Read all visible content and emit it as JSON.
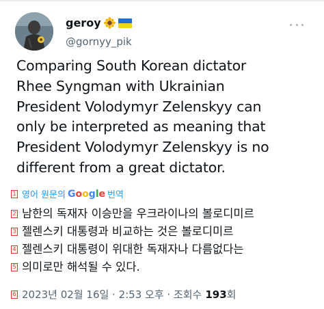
{
  "author": {
    "display_name": "geroy",
    "handle": "@gornyy_pik",
    "avatar_icon": "profile-avatar",
    "name_emojis": [
      "sunflower-icon",
      "ukraine-flag-icon"
    ]
  },
  "tweet": {
    "lines": [
      "Comparing South Korean dictator",
      "Rhee  Syngman with Ukrainian",
      "President Volodymyr Zelenskyy can",
      "only be interpreted as meaning that",
      "President Volodymyr Zelenskyy is no",
      "different from a great dictator."
    ]
  },
  "translate": {
    "marker": "1",
    "prefix": "영어 원문의",
    "google_letters": [
      "G",
      "o",
      "o",
      "g",
      "l",
      "e"
    ],
    "suffix": "번역"
  },
  "translation": {
    "lines": [
      {
        "marker": "2",
        "text": "남한의 독재자 이승만을 우크라이나의 볼로디미르"
      },
      {
        "marker": "3",
        "text": "젤렌스키 대통령과 비교하는 것은 볼로디미르"
      },
      {
        "marker": "4",
        "text": "젤렌스키 대통령이 위대한 독재자나 다름없다는"
      },
      {
        "marker": "5",
        "text": "의미로만 해석될 수 있다."
      }
    ]
  },
  "meta": {
    "marker": "6",
    "timestamp": "2023년 02월 16일 · 2:53 오후 · 조회수",
    "views_count": "193",
    "views_label": "회"
  },
  "colors": {
    "link": "#1d9bf0",
    "marker": "#e0342c",
    "secondary_text": "#536471"
  }
}
